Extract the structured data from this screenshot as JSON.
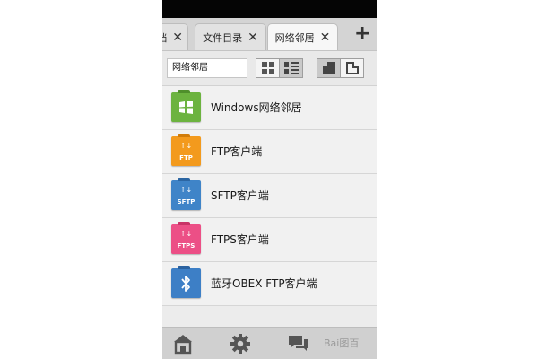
{
  "tabs": [
    {
      "label": "档",
      "close": "✕"
    },
    {
      "label": "文件目录",
      "close": "✕"
    },
    {
      "label": "网络邻居",
      "close": "✕"
    }
  ],
  "add_tab_symbol": "+",
  "toolbar": {
    "path_text": "网络邻居"
  },
  "items": [
    {
      "label": "Windows网络邻居",
      "color": "#6cb33f",
      "tab_color": "#4f8f2b",
      "tag": "",
      "arrows": false,
      "icon": "windows-logo-icon"
    },
    {
      "label": "FTP客户端",
      "color": "#f39a1d",
      "tab_color": "#d17c0a",
      "tag": "FTP",
      "arrows": true,
      "icon": "ftp-folder-icon"
    },
    {
      "label": "SFTP客户端",
      "color": "#3f84c8",
      "tab_color": "#2c66a3",
      "tag": "SFTP",
      "arrows": true,
      "icon": "sftp-folder-icon"
    },
    {
      "label": "FTPS客户端",
      "color": "#ec4f86",
      "tab_color": "#c93367",
      "tag": "FTPS",
      "arrows": true,
      "icon": "ftps-folder-icon"
    },
    {
      "label": "蓝牙OBEX FTP客户端",
      "color": "#3d7fc6",
      "tab_color": "#2b62a0",
      "tag": "",
      "arrows": false,
      "icon": "bluetooth-icon"
    }
  ],
  "bottom_bar": {
    "icons": [
      "home-icon",
      "gear-icon",
      "chat-icon"
    ],
    "watermark": "Bai图百"
  }
}
